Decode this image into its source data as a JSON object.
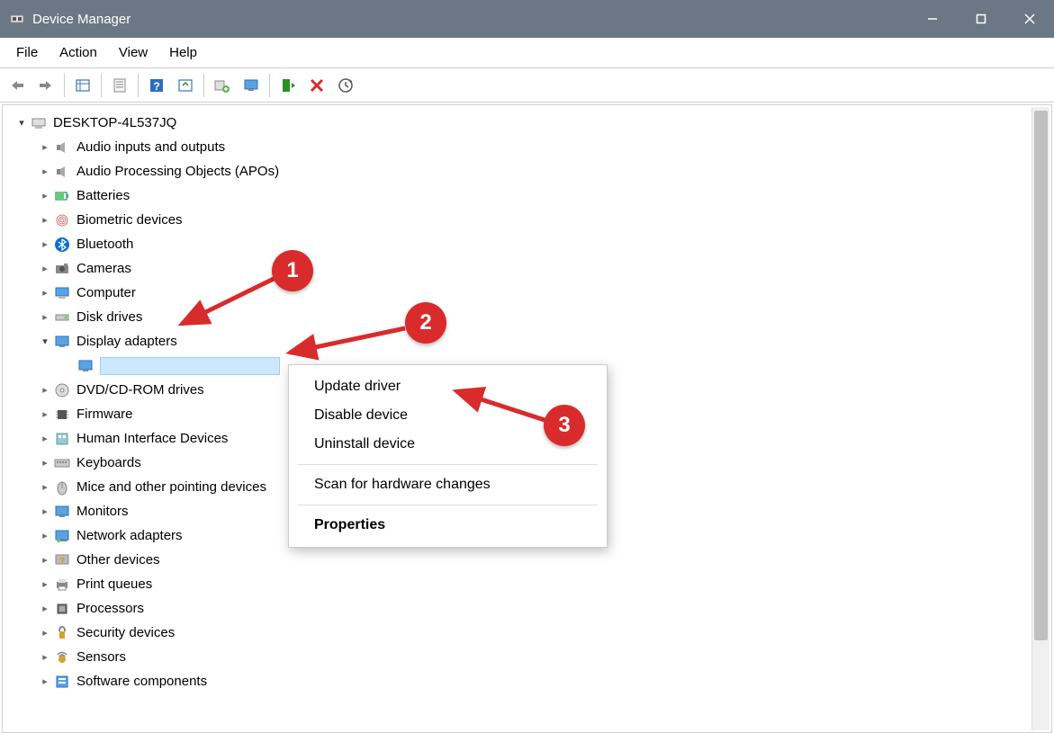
{
  "window": {
    "title": "Device Manager"
  },
  "menubar": {
    "file": "File",
    "action": "Action",
    "view": "View",
    "help": "Help"
  },
  "tree": {
    "root": "DESKTOP-4L537JQ",
    "items": [
      {
        "label": "Audio inputs and outputs",
        "icon": "speaker"
      },
      {
        "label": "Audio Processing Objects (APOs)",
        "icon": "speaker"
      },
      {
        "label": "Batteries",
        "icon": "battery"
      },
      {
        "label": "Biometric devices",
        "icon": "fingerprint"
      },
      {
        "label": "Bluetooth",
        "icon": "bluetooth"
      },
      {
        "label": "Cameras",
        "icon": "camera"
      },
      {
        "label": "Computer",
        "icon": "computer"
      },
      {
        "label": "Disk drives",
        "icon": "disk"
      },
      {
        "label": "Display adapters",
        "icon": "display",
        "expanded": true
      },
      {
        "label": "DVD/CD-ROM drives",
        "icon": "dvd"
      },
      {
        "label": "Firmware",
        "icon": "chip"
      },
      {
        "label": "Human Interface Devices",
        "icon": "hid"
      },
      {
        "label": "Keyboards",
        "icon": "keyboard"
      },
      {
        "label": "Mice and other pointing devices",
        "icon": "mouse"
      },
      {
        "label": "Monitors",
        "icon": "display"
      },
      {
        "label": "Network adapters",
        "icon": "network"
      },
      {
        "label": "Other devices",
        "icon": "unknown"
      },
      {
        "label": "Print queues",
        "icon": "printer"
      },
      {
        "label": "Processors",
        "icon": "cpu"
      },
      {
        "label": "Security devices",
        "icon": "security"
      },
      {
        "label": "Sensors",
        "icon": "sensor"
      },
      {
        "label": "Software components",
        "icon": "software"
      }
    ],
    "selected_child": ""
  },
  "context_menu": {
    "update": "Update driver",
    "disable": "Disable device",
    "uninstall": "Uninstall device",
    "scan": "Scan for hardware changes",
    "properties": "Properties"
  },
  "badges": {
    "one": "1",
    "two": "2",
    "three": "3"
  }
}
